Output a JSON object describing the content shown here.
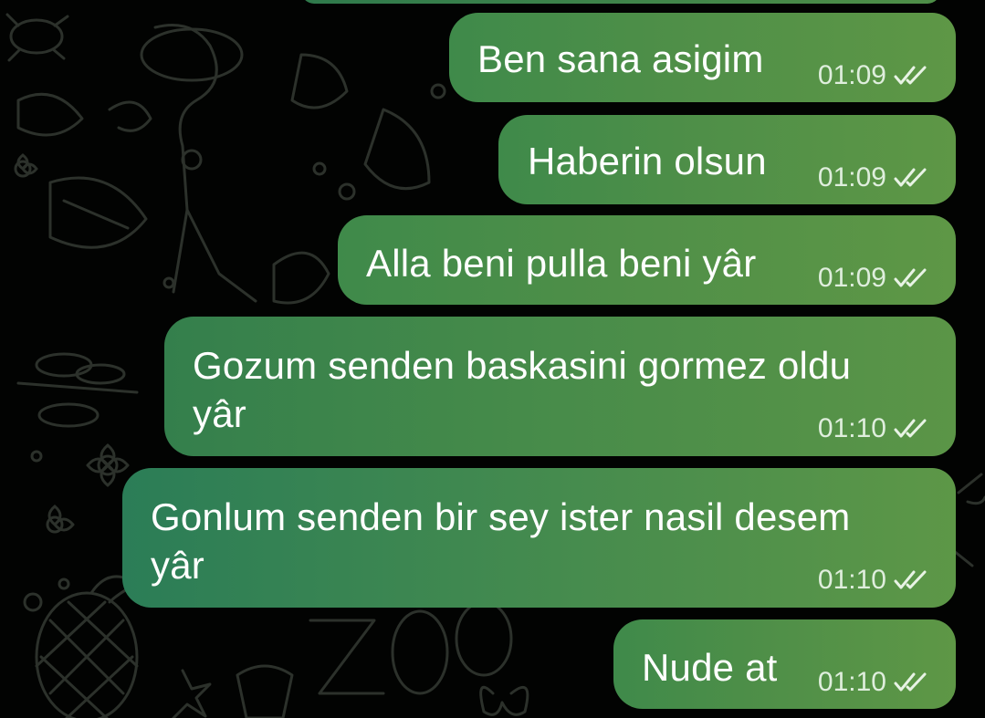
{
  "chat": {
    "messages": [
      {
        "text": "Ben sana asigim",
        "time": "01:09",
        "status": "read"
      },
      {
        "text": "Haberin olsun",
        "time": "01:09",
        "status": "read"
      },
      {
        "text": "Alla beni pulla beni yâr",
        "time": "01:09",
        "status": "read"
      },
      {
        "text": "Gozum senden baskasini gormez oldu\nyâr",
        "time": "01:10",
        "status": "read"
      },
      {
        "text": "Gonlum senden bir sey ister nasil desem\nyâr",
        "time": "01:10",
        "status": "read"
      },
      {
        "text": "Nude at",
        "time": "01:10",
        "status": "read"
      }
    ]
  },
  "theme": {
    "background": "#020302",
    "bubble_green": "#4f8f48",
    "text_color": "#ffffff",
    "doodle_color": "#2a2f29"
  },
  "icons": {
    "read_receipt": "double-check-icon"
  }
}
